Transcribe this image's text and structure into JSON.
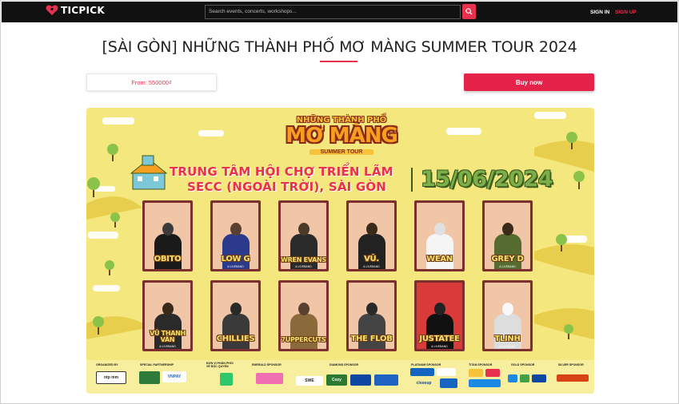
{
  "header": {
    "logo_text": "TICPICK",
    "search_placeholder": "Search events, concerts, workshops...",
    "signin_label": "SIGN IN",
    "signup_label": "SIGN UP",
    "accent_color": "#e8304f"
  },
  "event": {
    "title": "[SÀI GÒN] NHỮNG THÀNH PHỐ MƠ MÀNG SUMMER TOUR 2024",
    "price_label": "From: 550000₫",
    "buy_label": "Buy now"
  },
  "poster": {
    "tour_top": "NHỮNG THÀNH PHỐ",
    "tour_main": "MƠ MÀNG",
    "tour_sub": "SUMMER TOUR",
    "venue_line1": "TRUNG TÂM HỘI CHỢ TRIỂN LÃM",
    "venue_line2": "SECC (NGOÀI TRỜI), SÀI GÒN",
    "date": "15/06/2024",
    "artists_row1": [
      {
        "name": "OBITO",
        "sub": ""
      },
      {
        "name": "LOW G",
        "sub": "& LIVEBAND"
      },
      {
        "name": "WREN EVANS",
        "sub": "& LIVEBAND"
      },
      {
        "name": "VŨ.",
        "sub": "& LIVEBAND"
      },
      {
        "name": "WEAN",
        "sub": ""
      },
      {
        "name": "GREY D",
        "sub": "& LIVEBAND"
      }
    ],
    "artists_row2": [
      {
        "name": "VŨ THANH VÂN",
        "sub": "& LIVEBAND"
      },
      {
        "name": "CHILLIES",
        "sub": ""
      },
      {
        "name": "7UPPERCUTS",
        "sub": ""
      },
      {
        "name": "THE FLOB",
        "sub": ""
      },
      {
        "name": "JUSTATEE",
        "sub": "& LIVEBAND"
      },
      {
        "name": "TLINH",
        "sub": "& LIVEBAND"
      }
    ],
    "sponsors": {
      "organized_by": "ORGANIZED BY",
      "special_partnership": "SPECIAL PARTNERSHIP",
      "ticket_partner": "ĐƠN VỊ PHÂN PHỐI VÉ ĐỘC QUYỀN",
      "emerald": "EMERALD SPONSOR",
      "diamond": "DIAMOND SPONSOR",
      "platinum": "PLATINUM SPONSOR",
      "titan": "TITAN SPONSOR",
      "gold": "GOLD SPONSOR",
      "silver": "SILVER SPONSOR"
    },
    "sponsor_logos": {
      "ntpmm": "ntp mm",
      "vnpay": "VNPAY",
      "swe": "SWE",
      "cozy": "Cozy",
      "closeup": "closeup"
    }
  }
}
